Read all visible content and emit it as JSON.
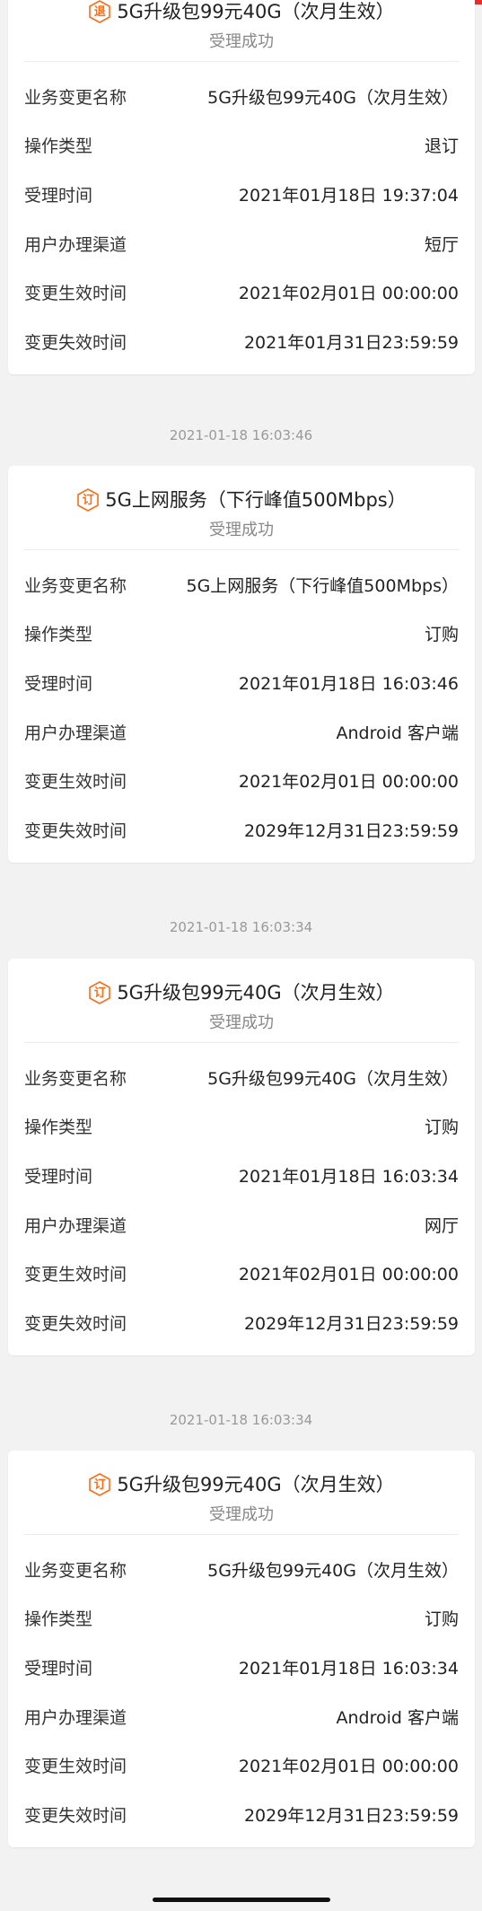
{
  "colors": {
    "accent": "#e52e2e",
    "badge": "#ff6a14"
  },
  "records": [
    {
      "timestamp": "",
      "badge_char": "退",
      "badge_icon": "unsubscribe-badge-icon",
      "title": "5G升级包99元40G（次月生效）",
      "status": "受理成功",
      "rows": [
        {
          "label": "业务变更名称",
          "value": "5G升级包99元40G（次月生效）"
        },
        {
          "label": "操作类型",
          "value": "退订"
        },
        {
          "label": "受理时间",
          "value": "2021年01月18日 19:37:04"
        },
        {
          "label": "用户办理渠道",
          "value": "短厅"
        },
        {
          "label": "变更生效时间",
          "value": "2021年02月01日 00:00:00"
        },
        {
          "label": "变更失效时间",
          "value": "2021年01月31日23:59:59"
        }
      ]
    },
    {
      "timestamp": "2021-01-18 16:03:46",
      "badge_char": "订",
      "badge_icon": "subscribe-badge-icon",
      "title": "5G上网服务（下行峰值500Mbps）",
      "status": "受理成功",
      "rows": [
        {
          "label": "业务变更名称",
          "value": "5G上网服务（下行峰值500Mbps）"
        },
        {
          "label": "操作类型",
          "value": "订购"
        },
        {
          "label": "受理时间",
          "value": "2021年01月18日 16:03:46"
        },
        {
          "label": "用户办理渠道",
          "value": "Android 客户端"
        },
        {
          "label": "变更生效时间",
          "value": "2021年02月01日 00:00:00"
        },
        {
          "label": "变更失效时间",
          "value": "2029年12月31日23:59:59"
        }
      ]
    },
    {
      "timestamp": "2021-01-18 16:03:34",
      "badge_char": "订",
      "badge_icon": "subscribe-badge-icon",
      "title": "5G升级包99元40G（次月生效）",
      "status": "受理成功",
      "rows": [
        {
          "label": "业务变更名称",
          "value": "5G升级包99元40G（次月生效）"
        },
        {
          "label": "操作类型",
          "value": "订购"
        },
        {
          "label": "受理时间",
          "value": "2021年01月18日 16:03:34"
        },
        {
          "label": "用户办理渠道",
          "value": "网厅"
        },
        {
          "label": "变更生效时间",
          "value": "2021年02月01日 00:00:00"
        },
        {
          "label": "变更失效时间",
          "value": "2029年12月31日23:59:59"
        }
      ]
    },
    {
      "timestamp": "2021-01-18 16:03:34",
      "badge_char": "订",
      "badge_icon": "subscribe-badge-icon",
      "title": "5G升级包99元40G（次月生效）",
      "status": "受理成功",
      "rows": [
        {
          "label": "业务变更名称",
          "value": "5G升级包99元40G（次月生效）"
        },
        {
          "label": "操作类型",
          "value": "订购"
        },
        {
          "label": "受理时间",
          "value": "2021年01月18日 16:03:34"
        },
        {
          "label": "用户办理渠道",
          "value": "Android 客户端"
        },
        {
          "label": "变更生效时间",
          "value": "2021年02月01日 00:00:00"
        },
        {
          "label": "变更失效时间",
          "value": "2029年12月31日23:59:59"
        }
      ]
    }
  ]
}
